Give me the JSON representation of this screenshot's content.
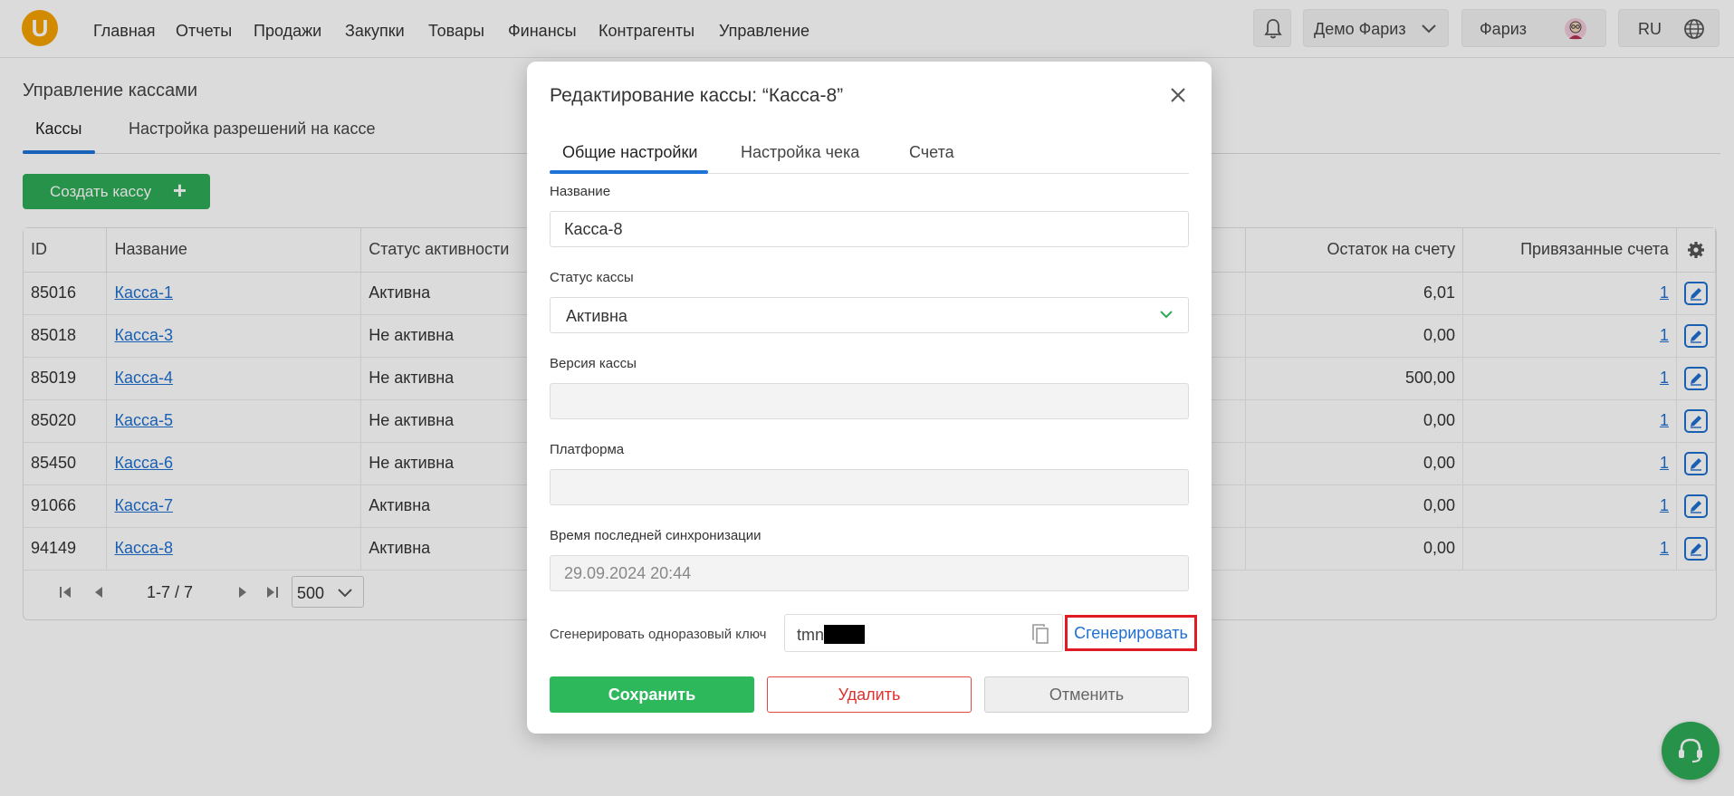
{
  "nav": {
    "logo_letter": "U",
    "items": [
      "Главная",
      "Отчеты",
      "Продажи",
      "Закупки",
      "Товары",
      "Финансы",
      "Контрагенты",
      "Управление"
    ],
    "company": "Демо Фариз",
    "user": "Фариз",
    "language": "RU"
  },
  "page": {
    "title": "Управление кассами",
    "tabs": [
      "Кассы",
      "Настройка разрешений на кассе"
    ],
    "create_button": "Создать кассу"
  },
  "table": {
    "headers": {
      "id": "ID",
      "name": "Название",
      "status": "Статус активности",
      "balance": "Остаток на счету",
      "accounts": "Привязанные счета"
    },
    "rows": [
      {
        "id": "85016",
        "name": "Касса-1",
        "status": "Активна",
        "balance": "6,01",
        "accounts": "1"
      },
      {
        "id": "85018",
        "name": "Касса-3",
        "status": "Не активна",
        "balance": "0,00",
        "accounts": "1"
      },
      {
        "id": "85019",
        "name": "Касса-4",
        "status": "Не активна",
        "balance": "500,00",
        "accounts": "1"
      },
      {
        "id": "85020",
        "name": "Касса-5",
        "status": "Не активна",
        "balance": "0,00",
        "accounts": "1"
      },
      {
        "id": "85450",
        "name": "Касса-6",
        "status": "Не активна",
        "balance": "0,00",
        "accounts": "1"
      },
      {
        "id": "91066",
        "name": "Касса-7",
        "status": "Активна",
        "balance": "0,00",
        "accounts": "1"
      },
      {
        "id": "94149",
        "name": "Касса-8",
        "status": "Активна",
        "balance": "0,00",
        "accounts": "1"
      }
    ]
  },
  "pager": {
    "range": "1-7 / 7",
    "page_size": "500"
  },
  "modal": {
    "title": "Редактирование кассы: “Касса-8”",
    "tabs": [
      "Общие настройки",
      "Настройка чека",
      "Счета"
    ],
    "fields": {
      "name_label": "Название",
      "name_value": "Касса-8",
      "status_label": "Статус кассы",
      "status_value": "Активна",
      "version_label": "Версия кассы",
      "version_value": "",
      "platform_label": "Платформа",
      "platform_value": "",
      "sync_label": "Время последней синхронизации",
      "sync_value": "29.09.2024 20:44"
    },
    "key": {
      "label": "Сгенерировать одноразовый ключ",
      "value_prefix": "tmn",
      "generate_button": "Сгенерировать"
    },
    "buttons": {
      "save": "Сохранить",
      "delete": "Удалить",
      "cancel": "Отменить"
    }
  },
  "colors": {
    "primary_green": "#2eb85c",
    "link_blue": "#1e6fd0",
    "highlight_red": "#e01b24",
    "logo_orange": "#f5a100"
  }
}
